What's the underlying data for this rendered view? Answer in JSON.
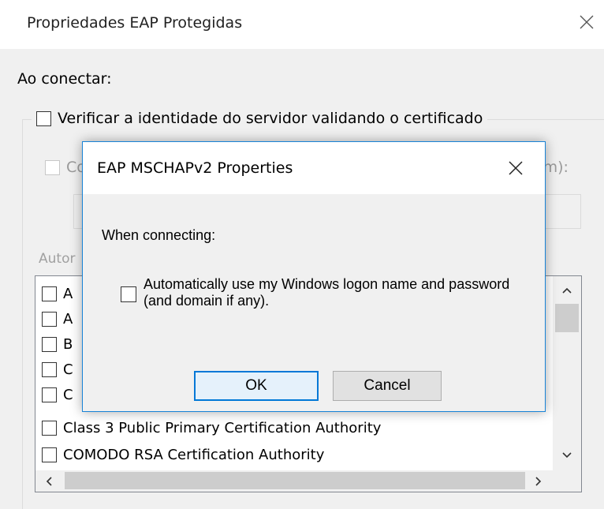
{
  "background_dialog": {
    "title": "Propriedades EAP Protegidas",
    "section_label": "Ao conectar:",
    "verify_server_label": "Verificar a identidade do servidor validando o certificado",
    "connect_label_start": "Co",
    "connect_label_end": "om):",
    "authorities_label": "Autor",
    "certificates": [
      {
        "label": "A",
        "checked": false
      },
      {
        "label": "A",
        "checked": false
      },
      {
        "label": "B",
        "checked": false
      },
      {
        "label": "C",
        "checked": false
      },
      {
        "label": "C",
        "checked": false
      },
      {
        "label": "Class 3 Public Primary Certification Authority",
        "checked": false
      },
      {
        "label": "COMODO RSA Certification Authority",
        "checked": false
      }
    ]
  },
  "modal": {
    "title": "EAP MSCHAPv2 Properties",
    "when_connecting_label": "When connecting:",
    "auto_logon_label": "Automatically use my Windows logon name and password (and domain if any).",
    "auto_logon_checked": false,
    "ok_label": "OK",
    "cancel_label": "Cancel"
  },
  "icons": {
    "close": "close-icon",
    "scroll_up": "chevron-up-icon",
    "scroll_down": "chevron-down-icon",
    "scroll_left": "chevron-left-icon",
    "scroll_right": "chevron-right-icon"
  },
  "colors": {
    "dialog_background": "#f0f0f0",
    "modal_border": "#1883d7",
    "default_button_border": "#0078d7"
  }
}
